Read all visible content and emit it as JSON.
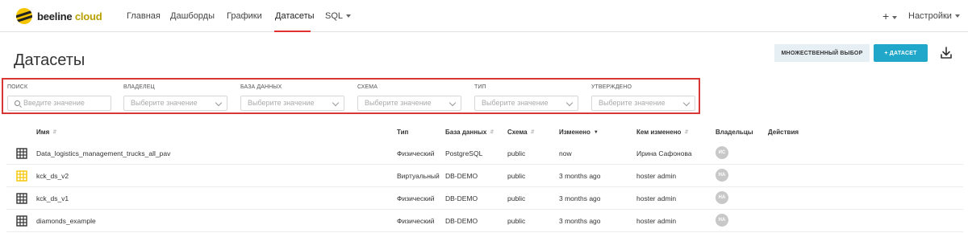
{
  "brand": {
    "name": "beeline",
    "suffix": "cloud",
    "accent": "#f5c400"
  },
  "nav": {
    "items": [
      "Главная",
      "Дашборды",
      "Графики",
      "Датасеты",
      "SQL"
    ],
    "active": "Датасеты",
    "plus": "+",
    "settings": "Настройки"
  },
  "page": {
    "title": "Датасеты",
    "multi_select_label": "МНОЖЕСТВЕННЫЙ ВЫБОР",
    "add_dataset_label": "+ ДАТАСЕТ"
  },
  "filters": [
    {
      "label": "ПОИСК",
      "placeholder": "Введите значение",
      "type": "search"
    },
    {
      "label": "ВЛАДЕЛЕЦ",
      "placeholder": "Выберите значение",
      "type": "select"
    },
    {
      "label": "БАЗА ДАННЫХ",
      "placeholder": "Выберите значение",
      "type": "select"
    },
    {
      "label": "СХЕМА",
      "placeholder": "Выберите значение",
      "type": "select"
    },
    {
      "label": "ТИП",
      "placeholder": "Выберите значение",
      "type": "select"
    },
    {
      "label": "УТВЕРЖДЕНО",
      "placeholder": "Выберите значение",
      "type": "select"
    }
  ],
  "table": {
    "headers": {
      "name": "Имя",
      "type": "Тип",
      "database": "База данных",
      "schema": "Схема",
      "modified": "Изменено",
      "modified_by": "Кем изменено",
      "owners": "Владельцы",
      "actions": "Действия"
    },
    "rows": [
      {
        "icon": "table-icon",
        "icon_color": "#333333",
        "name": "Data_logistics_management_trucks_all_pav",
        "type": "Физический",
        "database": "PostgreSQL",
        "schema": "public",
        "modified": "now",
        "modified_by": "Ирина Сафонова",
        "owner": "ИС"
      },
      {
        "icon": "table-icon",
        "icon_color": "#f5c400",
        "name": "kck_ds_v2",
        "type": "Виртуальный",
        "database": "DB-DEMO",
        "schema": "public",
        "modified": "3 months ago",
        "modified_by": "hoster admin",
        "owner": "HA"
      },
      {
        "icon": "table-icon",
        "icon_color": "#333333",
        "name": "kck_ds_v1",
        "type": "Физический",
        "database": "DB-DEMO",
        "schema": "public",
        "modified": "3 months ago",
        "modified_by": "hoster admin",
        "owner": "HA"
      },
      {
        "icon": "table-icon",
        "icon_color": "#333333",
        "name": "diamonds_example",
        "type": "Физический",
        "database": "DB-DEMO",
        "schema": "public",
        "modified": "3 months ago",
        "modified_by": "hoster admin",
        "owner": "HA"
      }
    ]
  }
}
